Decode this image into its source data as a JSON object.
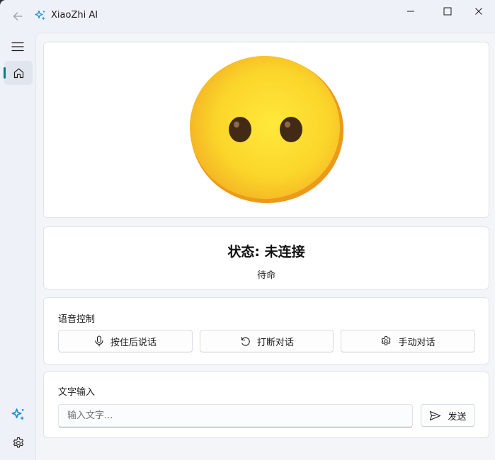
{
  "window": {
    "title": "XiaoZhi AI",
    "icons": {
      "back": "arrow-left-icon",
      "app": "sparkle-icon",
      "minimize": "minimize-icon",
      "maximize": "maximize-icon",
      "close": "close-icon"
    }
  },
  "nav": {
    "items": [
      {
        "id": "home",
        "icon": "home-icon",
        "selected": true
      }
    ],
    "footer_icons": [
      "sparkle-icon",
      "gear-icon"
    ],
    "accent": "#0b7a84"
  },
  "emoji": {
    "expression": "neutral face without mouth",
    "icon": "emoji-face-icon"
  },
  "status": {
    "title": "状态: 未连接",
    "subtitle": "待命"
  },
  "voice_control": {
    "label": "语音控制",
    "buttons": [
      {
        "label": "按住后说话",
        "icon": "microphone-icon"
      },
      {
        "label": "打断对话",
        "icon": "undo-icon"
      },
      {
        "label": "手动对话",
        "icon": "gear-icon"
      }
    ]
  },
  "text_input": {
    "label": "文字输入",
    "placeholder": "输入文字...",
    "value": "",
    "send_label": "发送",
    "send_icon": "send-icon"
  },
  "colors": {
    "accent": "#0b7a84",
    "emoji_yellow": "#fbd52a",
    "emoji_shadow": "#f0a21c",
    "app_icon_blue": "#1a8fd6"
  }
}
